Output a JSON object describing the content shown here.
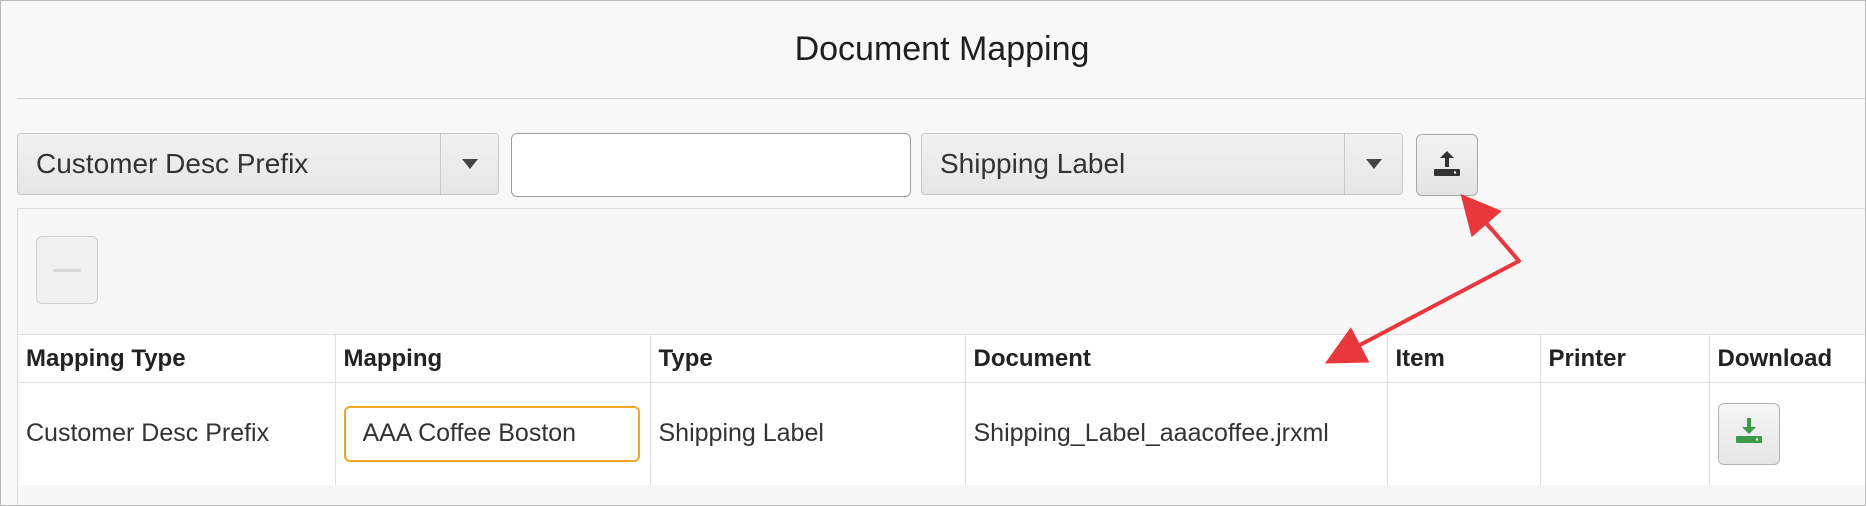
{
  "page": {
    "title": "Document Mapping"
  },
  "toolbar": {
    "mapping_type_select": {
      "selected": "Customer Desc Prefix",
      "icon": "chevron-down-icon"
    },
    "mapping_input": {
      "value": ""
    },
    "type_select": {
      "selected": "Shipping Label",
      "icon": "chevron-down-icon"
    },
    "upload_button": {
      "icon": "upload-icon"
    }
  },
  "panel": {
    "remove_button": {
      "icon": "minus-icon",
      "enabled": false
    }
  },
  "table": {
    "columns": [
      "Mapping Type",
      "Mapping",
      "Type",
      "Document",
      "Item",
      "Printer",
      "Download"
    ],
    "rows": [
      {
        "mapping_type": "Customer Desc Prefix",
        "mapping": "AAA Coffee Boston",
        "type": "Shipping Label",
        "document": "Shipping_Label_aaacoffee.jrxml",
        "item": "",
        "printer": "",
        "download_icon": "download-icon"
      }
    ]
  },
  "colors": {
    "annotation_arrow": "#e8383d",
    "download_icon": "#3c9a48",
    "focus_border": "#f0a428"
  }
}
